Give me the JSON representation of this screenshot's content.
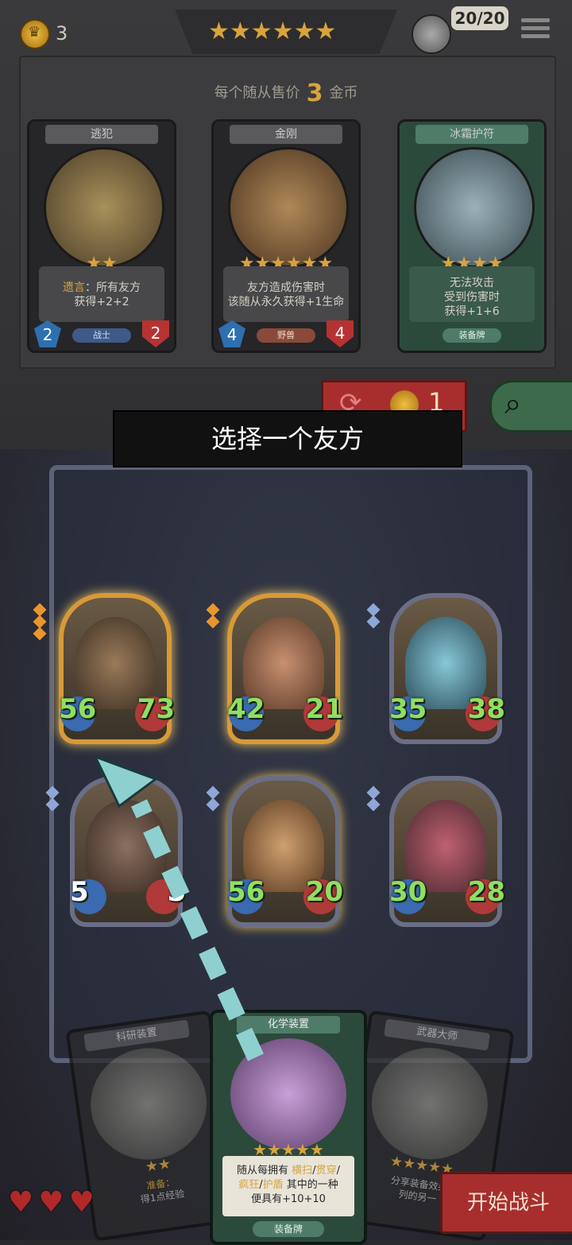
{
  "header": {
    "gold": "3",
    "tier_stars": "★★★★★★",
    "health": "20/20"
  },
  "shop": {
    "sell_prefix": "每个随从售价",
    "sell_price": "3",
    "sell_suffix": "金币",
    "cards": [
      {
        "name": "逃犯",
        "stars": "★★",
        "kw": "遗言",
        "desc_line1": "：所有友方",
        "desc_line2": "获得+2+2",
        "tribe": "战士",
        "attack": "2",
        "health": "2"
      },
      {
        "name": "金刚",
        "stars": "★★★★★★",
        "desc_line1": "友方造成伤害时",
        "desc_line2": "该随从永久获得+1生命",
        "tribe": "野兽",
        "attack": "4",
        "health": "4"
      },
      {
        "name": "冰霜护符",
        "stars": "★★★★",
        "desc_line1": "无法攻击",
        "desc_line2": "受到伤害时",
        "desc_line3": "获得+1+6",
        "tribe": "装备牌"
      }
    ],
    "refresh_cost": "1"
  },
  "prompt": "选择一个友方",
  "board": {
    "minions": [
      {
        "attack": "56",
        "health": "73"
      },
      {
        "attack": "42",
        "health": "21"
      },
      {
        "attack": "35",
        "health": "38"
      },
      {
        "attack": "5",
        "health": "5"
      },
      {
        "attack": "56",
        "health": "20"
      },
      {
        "attack": "30",
        "health": "28"
      }
    ]
  },
  "hand": {
    "left": {
      "name": "科研装置",
      "desc": "准备：",
      "desc2": "得1点经验"
    },
    "center": {
      "name": "化学装置",
      "stars": "★★★★★",
      "desc_pre": "随从每拥有",
      "kw1": "横扫",
      "kw2": "贯穿",
      "kw3": "疯狂",
      "kw4": "护盾",
      "desc_mid": "其中的一种",
      "desc_post": "便具有+10+10",
      "tribe": "装备牌"
    },
    "right": {
      "name": "武器大师",
      "desc": "分享装备效果",
      "desc2": "列的另一"
    }
  },
  "lives": [
    "♥",
    "♥",
    "♥"
  ],
  "start_battle": "开始战斗"
}
